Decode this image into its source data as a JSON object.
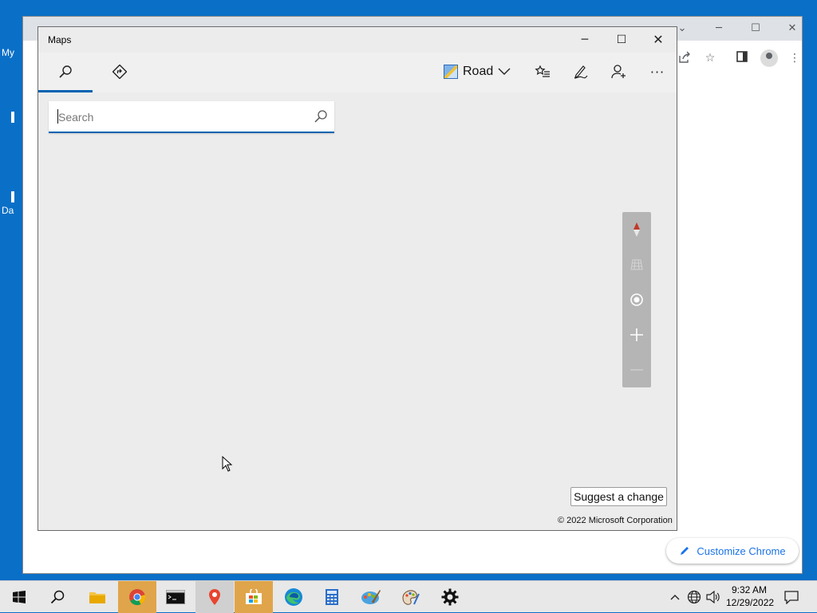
{
  "desktop": {
    "peek_labels": [
      "My",
      "Da"
    ]
  },
  "maps_window": {
    "title": "Maps",
    "tabs": [
      {
        "name": "search-tab",
        "icon": "search-icon",
        "active": true
      },
      {
        "name": "directions-tab",
        "icon": "directions-icon",
        "active": false
      }
    ],
    "map_style": {
      "label": "Road",
      "icon": "road-map-icon"
    },
    "toolbar_icons": [
      "favorites-icon",
      "ink-pen-icon",
      "person-add-icon",
      "more-icon"
    ],
    "more_glyph": "···",
    "search": {
      "placeholder": "Search",
      "value": ""
    },
    "map_controls": [
      "compass-icon",
      "grid-3d-icon",
      "locate-icon",
      "zoom-in-icon",
      "zoom-out-icon"
    ],
    "suggest_label": "Suggest a change",
    "copyright": "© 2022 Microsoft Corporation"
  },
  "chrome_window": {
    "customize_label": "Customize Chrome"
  },
  "taskbar": {
    "apps": [
      "start-icon",
      "search-icon",
      "file-explorer-icon",
      "chrome-icon",
      "terminal-icon",
      "maps-icon",
      "store-icon",
      "edge-icon",
      "calculator-icon",
      "paint-icon",
      "paint3d-icon",
      "settings-icon"
    ],
    "clock": {
      "time": "9:32 AM",
      "date": "12/29/2022"
    }
  },
  "colors": {
    "accent": "#0063b1",
    "taskbar_running": "#e0a54a"
  }
}
